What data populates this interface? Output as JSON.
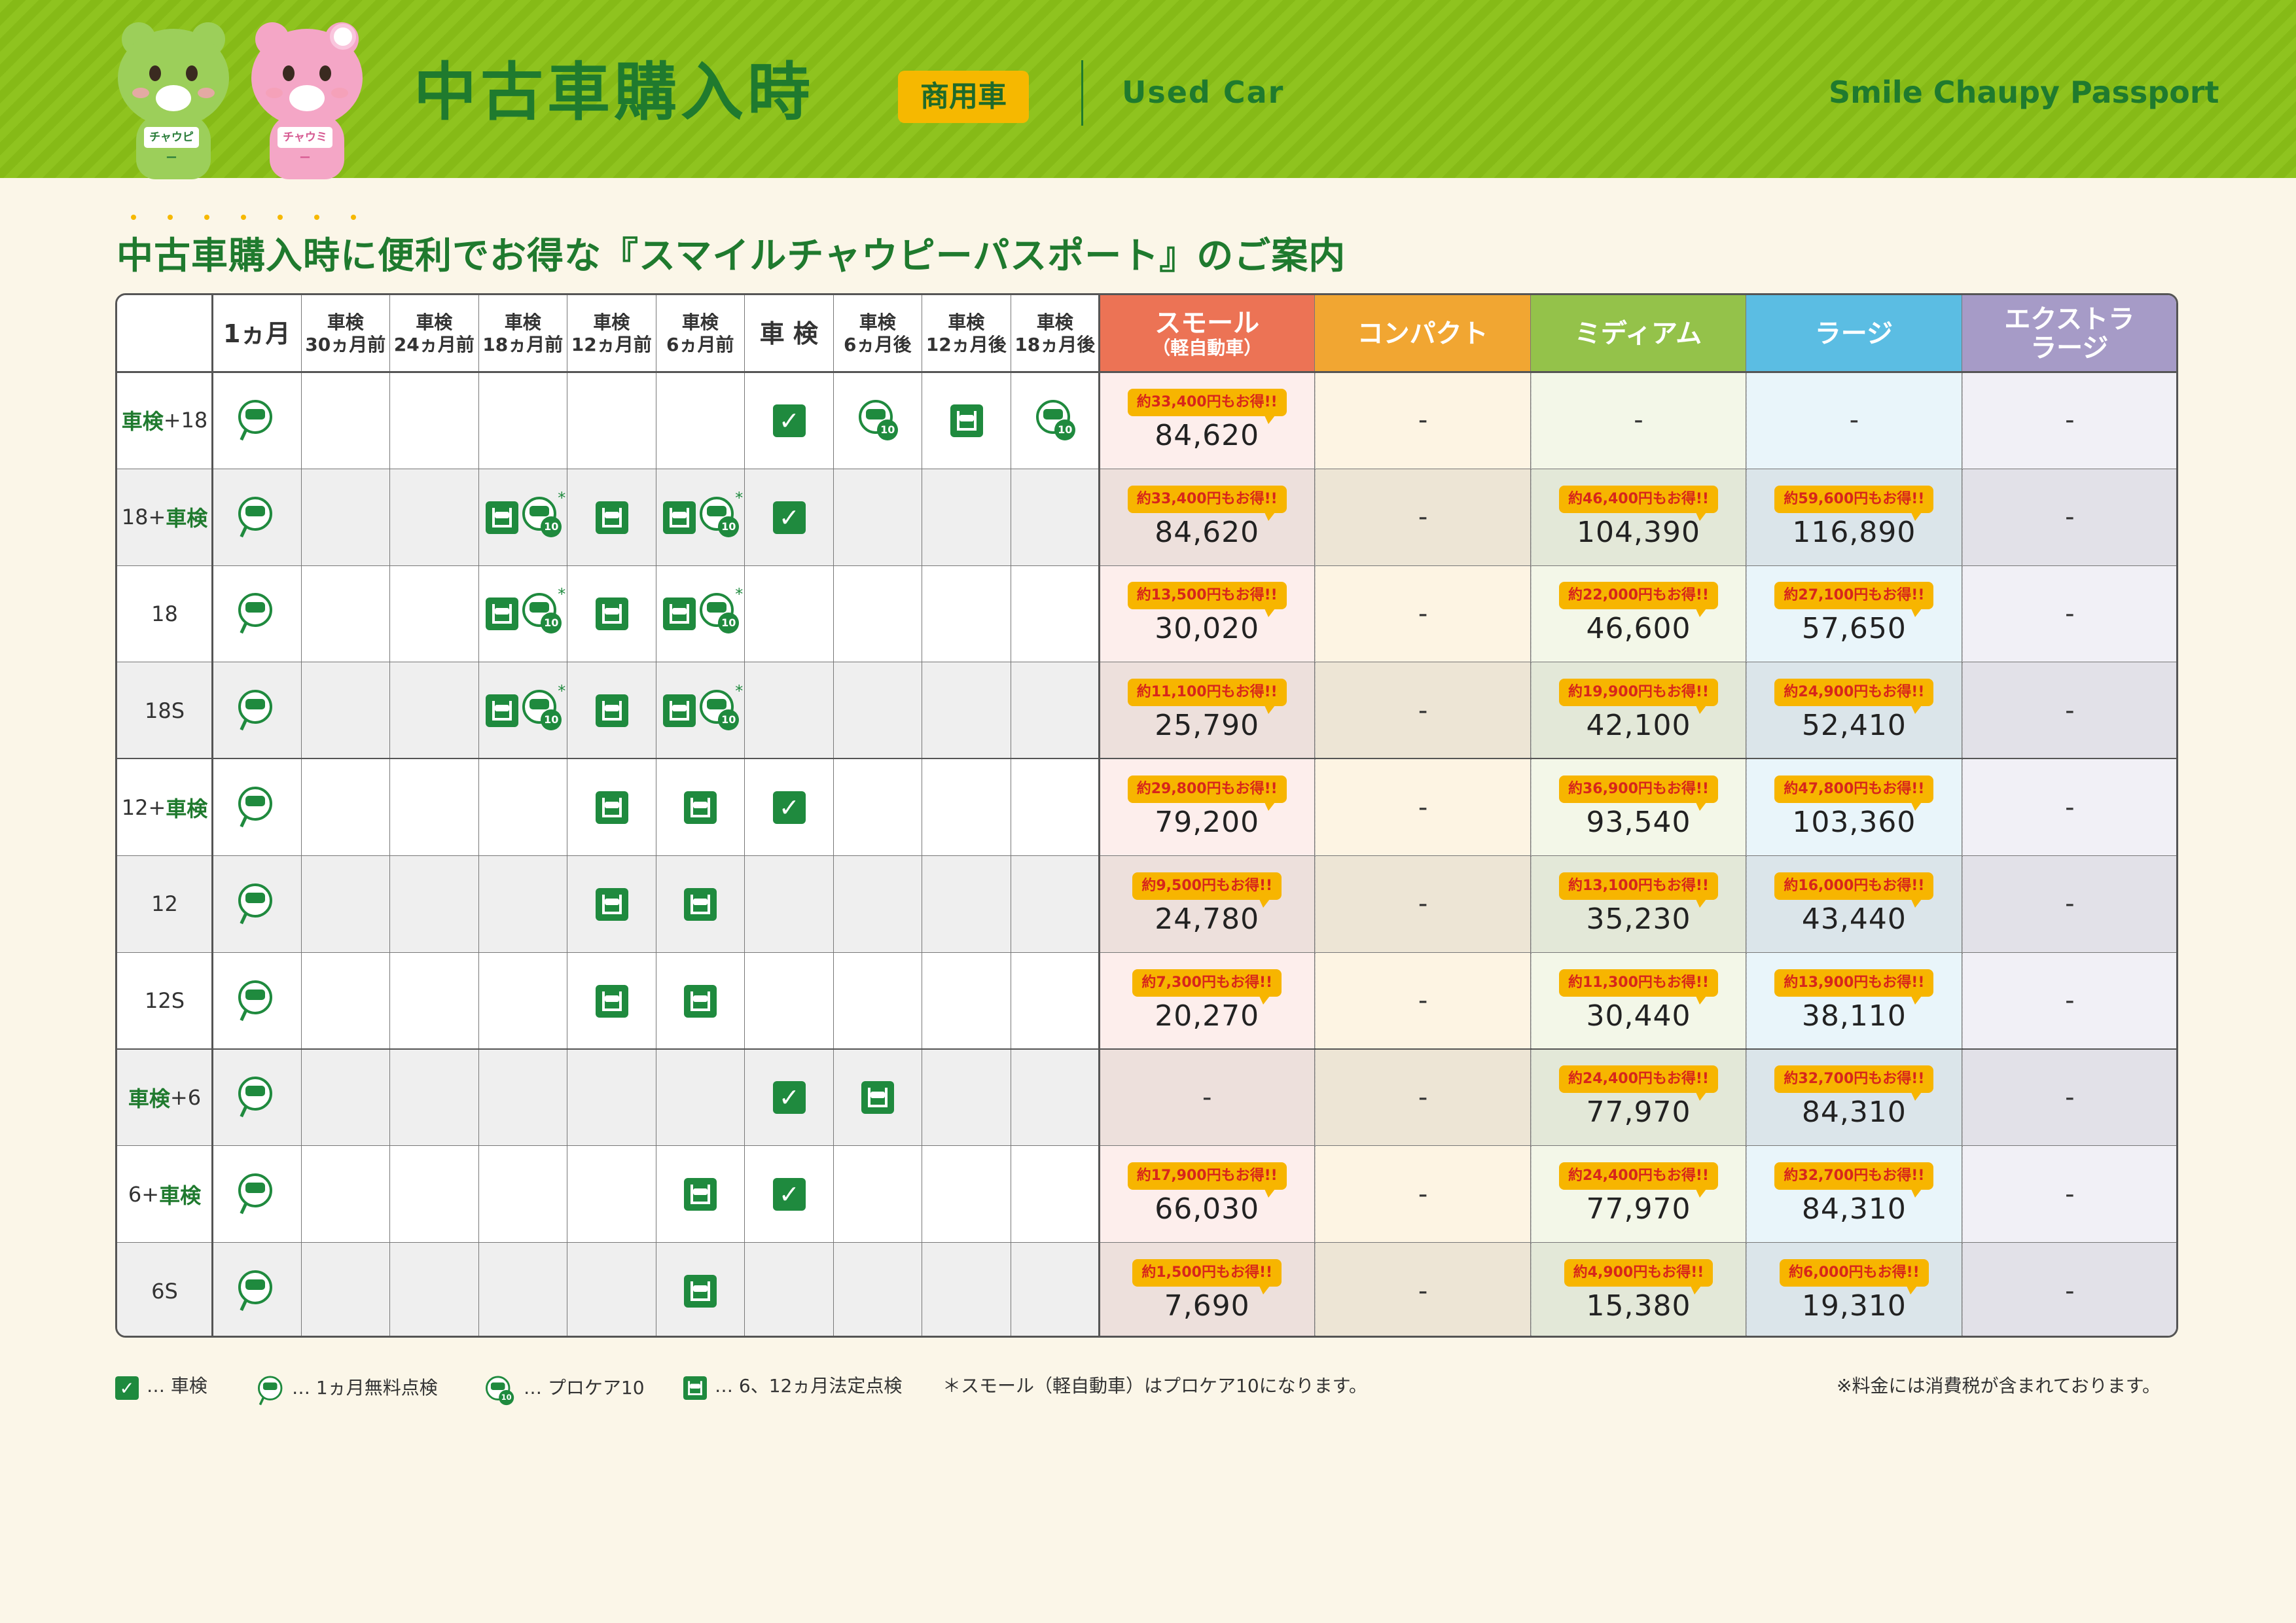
{
  "header": {
    "title": "中古車購入時",
    "badge": "商用車",
    "subtitle_en": "Used Car",
    "brand": "Smile Chaupy Passport",
    "mascot_left_tag": "チャウピー",
    "mascot_right_tag": "チャウミー"
  },
  "subtitle": "中古車購入時に便利でお得な『スマイルチャウピーパスポート』のご案内",
  "table": {
    "schedule_headers": [
      {
        "l1": "1ヵ月",
        "l2": ""
      },
      {
        "l1": "車検",
        "l2": "30ヵ月前"
      },
      {
        "l1": "車検",
        "l2": "24ヵ月前"
      },
      {
        "l1": "車検",
        "l2": "18ヵ月前"
      },
      {
        "l1": "車検",
        "l2": "12ヵ月前"
      },
      {
        "l1": "車検",
        "l2": "6ヵ月前"
      },
      {
        "l1": "車 検",
        "l2": ""
      },
      {
        "l1": "車検",
        "l2": "6ヵ月後"
      },
      {
        "l1": "車検",
        "l2": "12ヵ月後"
      },
      {
        "l1": "車検",
        "l2": "18ヵ月後"
      }
    ],
    "size_headers": [
      {
        "l1": "スモール",
        "l2": "（軽自動車）",
        "color": "#ec7355"
      },
      {
        "l1": "コンパクト",
        "l2": "",
        "color": "#f1a632"
      },
      {
        "l1": "ミディアム",
        "l2": "",
        "color": "#94c24a"
      },
      {
        "l1": "ラージ",
        "l2": "",
        "color": "#5bbde3"
      },
      {
        "l1": "エクストラ",
        "l2": "ラージ",
        "color": "#a69bc7"
      }
    ],
    "rows": [
      {
        "pre": "車検",
        "label": "+18",
        "post": "",
        "icons": [
          [
            "check"
          ],
          [],
          [],
          [],
          [],
          [],
          [
            "wrench"
          ],
          [
            "pro"
          ],
          [
            "lift"
          ],
          [
            "pro"
          ]
        ],
        "prices": [
          {
            "deal": "約33,400円もお得!!",
            "value": "84,620"
          },
          {
            "value": "-"
          },
          {
            "value": "-"
          },
          {
            "value": "-"
          },
          {
            "value": "-"
          }
        ]
      },
      {
        "pre": "",
        "label": "18+",
        "post": "車検",
        "icons": [
          [
            "check"
          ],
          [],
          [],
          [
            "lift",
            "pro*"
          ],
          [
            "lift"
          ],
          [
            "lift",
            "pro*"
          ],
          [
            "wrench"
          ],
          [],
          [],
          []
        ],
        "prices": [
          {
            "deal": "約33,400円もお得!!",
            "value": "84,620"
          },
          {
            "value": "-"
          },
          {
            "deal": "約46,400円もお得!!",
            "value": "104,390"
          },
          {
            "deal": "約59,600円もお得!!",
            "value": "116,890"
          },
          {
            "value": "-"
          }
        ]
      },
      {
        "pre": "",
        "label": "18",
        "post": "",
        "icons": [
          [
            "check"
          ],
          [],
          [],
          [
            "lift",
            "pro*"
          ],
          [
            "lift"
          ],
          [
            "lift",
            "pro*"
          ],
          [],
          [],
          [],
          []
        ],
        "prices": [
          {
            "deal": "約13,500円もお得!!",
            "value": "30,020"
          },
          {
            "value": "-"
          },
          {
            "deal": "約22,000円もお得!!",
            "value": "46,600"
          },
          {
            "deal": "約27,100円もお得!!",
            "value": "57,650"
          },
          {
            "value": "-"
          }
        ]
      },
      {
        "pre": "",
        "label": "18S",
        "post": "",
        "icons": [
          [
            "check"
          ],
          [],
          [],
          [
            "lift",
            "pro*"
          ],
          [
            "lift"
          ],
          [
            "lift",
            "pro*"
          ],
          [],
          [],
          [],
          []
        ],
        "prices": [
          {
            "deal": "約11,100円もお得!!",
            "value": "25,790"
          },
          {
            "value": "-"
          },
          {
            "deal": "約19,900円もお得!!",
            "value": "42,100"
          },
          {
            "deal": "約24,900円もお得!!",
            "value": "52,410"
          },
          {
            "value": "-"
          }
        ]
      },
      {
        "pre": "",
        "label": "12+",
        "post": "車検",
        "icons": [
          [
            "check"
          ],
          [],
          [],
          [],
          [
            "lift"
          ],
          [
            "lift"
          ],
          [
            "wrench"
          ],
          [],
          [],
          []
        ],
        "prices": [
          {
            "deal": "約29,800円もお得!!",
            "value": "79,200"
          },
          {
            "value": "-"
          },
          {
            "deal": "約36,900円もお得!!",
            "value": "93,540"
          },
          {
            "deal": "約47,800円もお得!!",
            "value": "103,360"
          },
          {
            "value": "-"
          }
        ]
      },
      {
        "pre": "",
        "label": "12",
        "post": "",
        "icons": [
          [
            "check"
          ],
          [],
          [],
          [],
          [
            "lift"
          ],
          [
            "lift"
          ],
          [],
          [],
          [],
          []
        ],
        "prices": [
          {
            "deal": "約9,500円もお得!!",
            "value": "24,780"
          },
          {
            "value": "-"
          },
          {
            "deal": "約13,100円もお得!!",
            "value": "35,230"
          },
          {
            "deal": "約16,000円もお得!!",
            "value": "43,440"
          },
          {
            "value": "-"
          }
        ]
      },
      {
        "pre": "",
        "label": "12S",
        "post": "",
        "icons": [
          [
            "check"
          ],
          [],
          [],
          [],
          [
            "lift"
          ],
          [
            "lift"
          ],
          [],
          [],
          [],
          []
        ],
        "prices": [
          {
            "deal": "約7,300円もお得!!",
            "value": "20,270"
          },
          {
            "value": "-"
          },
          {
            "deal": "約11,300円もお得!!",
            "value": "30,440"
          },
          {
            "deal": "約13,900円もお得!!",
            "value": "38,110"
          },
          {
            "value": "-"
          }
        ]
      },
      {
        "pre": "車検",
        "label": "+6",
        "post": "",
        "icons": [
          [
            "check"
          ],
          [],
          [],
          [],
          [],
          [],
          [
            "wrench"
          ],
          [
            "lift"
          ],
          [],
          []
        ],
        "prices": [
          {
            "value": "-"
          },
          {
            "value": "-"
          },
          {
            "deal": "約24,400円もお得!!",
            "value": "77,970"
          },
          {
            "deal": "約32,700円もお得!!",
            "value": "84,310"
          },
          {
            "value": "-"
          }
        ]
      },
      {
        "pre": "",
        "label": "6+",
        "post": "車検",
        "icons": [
          [
            "check"
          ],
          [],
          [],
          [],
          [],
          [
            "lift"
          ],
          [
            "wrench"
          ],
          [],
          [],
          []
        ],
        "prices": [
          {
            "deal": "約17,900円もお得!!",
            "value": "66,030"
          },
          {
            "value": "-"
          },
          {
            "deal": "約24,400円もお得!!",
            "value": "77,970"
          },
          {
            "deal": "約32,700円もお得!!",
            "value": "84,310"
          },
          {
            "value": "-"
          }
        ]
      },
      {
        "pre": "",
        "label": "6S",
        "post": "",
        "icons": [
          [
            "check"
          ],
          [],
          [],
          [],
          [],
          [
            "lift"
          ],
          [],
          [],
          [],
          []
        ],
        "prices": [
          {
            "deal": "約1,500円もお得!!",
            "value": "7,690"
          },
          {
            "value": "-"
          },
          {
            "deal": "約4,900円もお得!!",
            "value": "15,380"
          },
          {
            "deal": "約6,000円もお得!!",
            "value": "19,310"
          },
          {
            "value": "-"
          }
        ]
      }
    ],
    "price_bg_light": [
      "#fdeeec",
      "#fdf4e3",
      "#f3f7e8",
      "#e9f5fa",
      "#f1f0f6"
    ],
    "price_bg_dark": [
      "#ede0dc",
      "#ede5d5",
      "#e3e8d8",
      "#dbe5ea",
      "#e2e1e8"
    ]
  },
  "legend": {
    "wrench": "… 車検",
    "check": "… 1ヵ月無料点検",
    "pro": "… プロケア10",
    "lift": "… 6、12ヵ月法定点検",
    "note": "＊スモール（軽自動車）はプロケア10になります。",
    "tax_note": "※料金には消費税が含まれております。",
    "pro_badge": "10",
    "wrench_glyph": "✓"
  }
}
